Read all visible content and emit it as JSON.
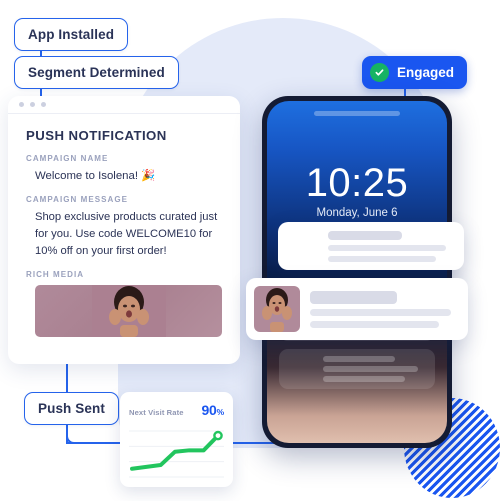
{
  "flow": {
    "labels": [
      {
        "id": "app-installed",
        "text": "App Installed"
      },
      {
        "id": "segment-determined",
        "text": "Segment Determined"
      },
      {
        "id": "push-sent",
        "text": "Push Sent"
      }
    ],
    "badge": {
      "text": "Engaged",
      "icon": "check-circle-icon",
      "bg": "#1a56f0",
      "check_color": "#16b364"
    }
  },
  "push_card": {
    "title": "PUSH NOTIFICATION",
    "fields": [
      {
        "label": "CAMPAIGN NAME",
        "value": "Welcome to Isolena! 🎉"
      },
      {
        "label": "CAMPAIGN MESSAGE",
        "value": "Shop exclusive products curated just for you. Use code WELCOME10 for 10% off on your first order!"
      }
    ],
    "media_label": "RICH MEDIA",
    "media_alt": "woman-smiling-photo"
  },
  "phone": {
    "time": "10:25",
    "date": "Monday, June 6",
    "notifications": [
      {
        "thumb": "photo-thumbnail"
      },
      {
        "thumb": "photo-thumbnail"
      }
    ]
  },
  "float_cards": [
    {
      "thumb": "photo-thumbnail-warm"
    },
    {
      "thumb": "photo-thumbnail-pink"
    }
  ],
  "metric": {
    "title": "Next Visit Rate",
    "value": "90",
    "unit": "%",
    "accent": "#1a56f0"
  },
  "chart_data": {
    "type": "line",
    "title": "Next Visit Rate",
    "x": [
      0,
      1,
      2,
      3,
      4,
      5,
      6
    ],
    "values": [
      18,
      22,
      26,
      55,
      58,
      58,
      90
    ],
    "ylim": [
      0,
      100
    ],
    "xlabel": "",
    "ylabel": "",
    "grid": true,
    "legend": "none",
    "series_color": "#22c55e",
    "end_marker": true
  },
  "colors": {
    "backdrop": "#e4eaf9",
    "connector": "#2563eb",
    "stripes": "#1a56f0",
    "text_dark": "#2b3356",
    "text_muted": "#9aa1bd"
  }
}
